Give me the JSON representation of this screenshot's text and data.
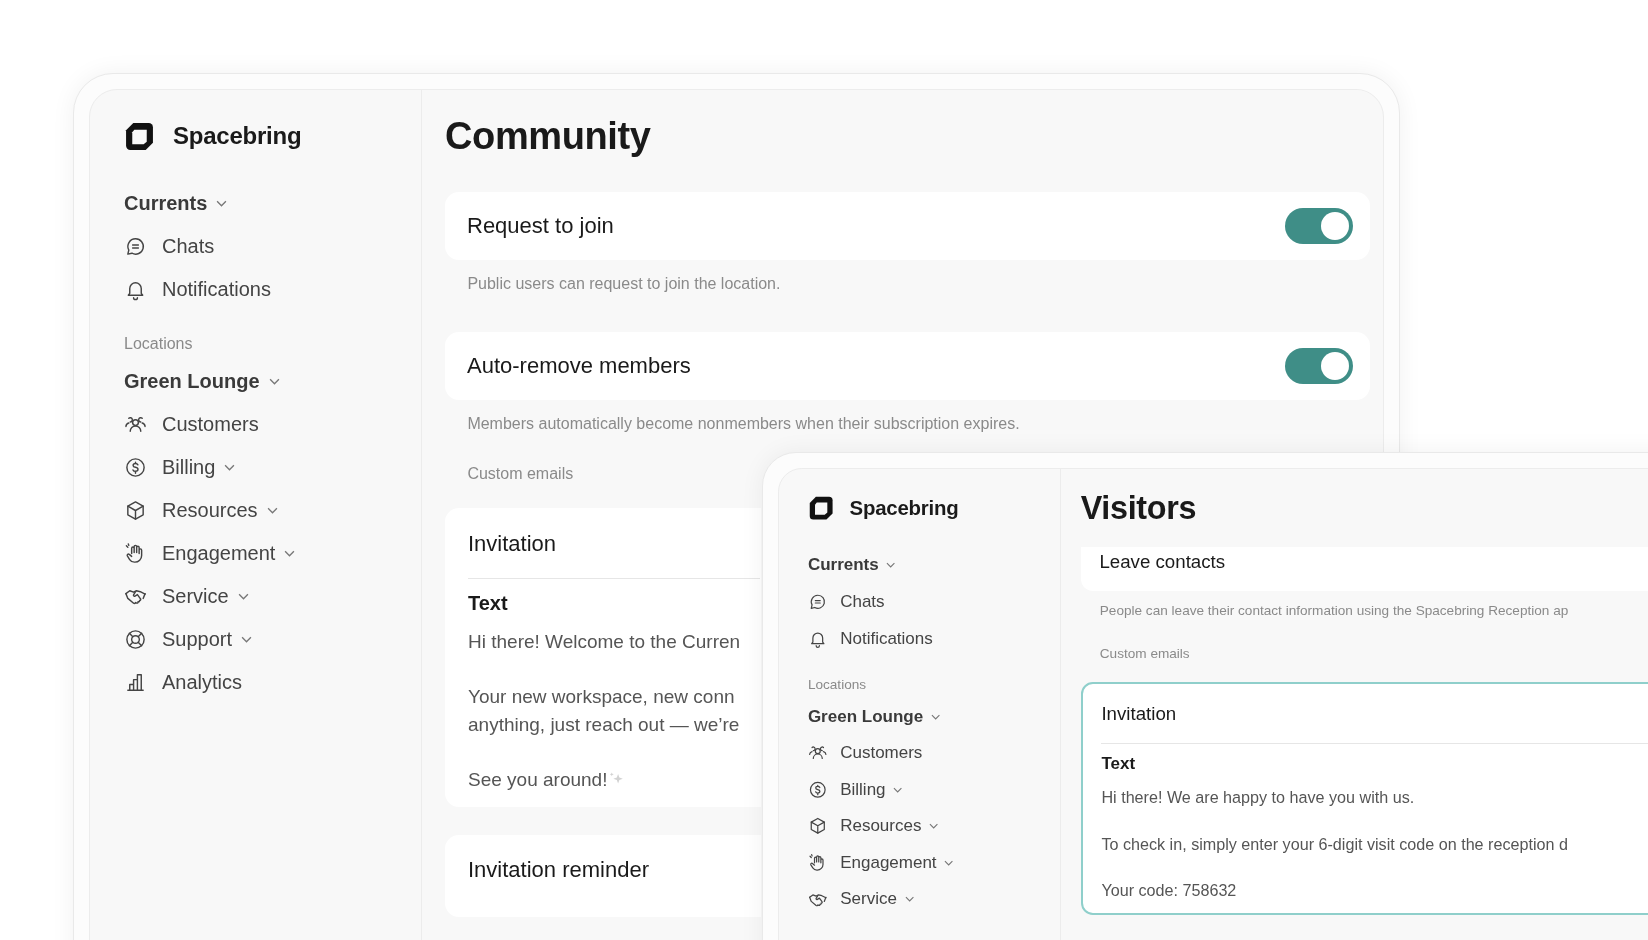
{
  "windows": [
    {
      "brand": "Spacebring",
      "sidebar": [
        {
          "kind": "group",
          "label": "Currents"
        },
        {
          "kind": "item",
          "label": "Chats",
          "expandable": false
        },
        {
          "kind": "item",
          "label": "Notifications",
          "expandable": false
        },
        {
          "kind": "caption",
          "label": "Locations"
        },
        {
          "kind": "group",
          "label": "Green Lounge"
        },
        {
          "kind": "item",
          "label": "Customers",
          "expandable": false
        },
        {
          "kind": "item",
          "label": "Billing",
          "expandable": true
        },
        {
          "kind": "item",
          "label": "Resources",
          "expandable": true
        },
        {
          "kind": "item",
          "label": "Engagement",
          "expandable": true
        },
        {
          "kind": "item",
          "label": "Service",
          "expandable": true
        },
        {
          "kind": "item",
          "label": "Support",
          "expandable": true
        },
        {
          "kind": "item",
          "label": "Analytics",
          "expandable": false
        }
      ],
      "main": {
        "title": "Community",
        "scrolled": false,
        "overlapped": true,
        "settings": [
          {
            "label": "Request to join",
            "on": true,
            "description": "Public users can request to join the location."
          },
          {
            "label": "Auto-remove members",
            "on": true,
            "description": "Members automatically become nonmembers when their subscription expires."
          }
        ],
        "emails_label": "Custom emails",
        "emails": [
          {
            "title": "Invitation",
            "selected": false,
            "field_label": "Text",
            "paragraphs": [
              {
                "text": "Hi there! Welcome to the Curren"
              },
              {
                "text": "Your new workspace, new conn\nanything, just reach out — we’re"
              },
              {
                "text": "See you around!"
              }
            ]
          },
          {
            "title": "Invitation reminder",
            "selected": false
          }
        ]
      }
    },
    {
      "brand": "Spacebring",
      "sidebar": [
        {
          "kind": "group",
          "label": "Currents"
        },
        {
          "kind": "item",
          "label": "Chats",
          "expandable": false
        },
        {
          "kind": "item",
          "label": "Notifications",
          "expandable": false
        },
        {
          "kind": "caption",
          "label": "Locations"
        },
        {
          "kind": "group",
          "label": "Green Lounge"
        },
        {
          "kind": "item",
          "label": "Customers",
          "expandable": false
        },
        {
          "kind": "item",
          "label": "Billing",
          "expandable": true
        },
        {
          "kind": "item",
          "label": "Resources",
          "expandable": true
        },
        {
          "kind": "item",
          "label": "Engagement",
          "expandable": true
        },
        {
          "kind": "item",
          "label": "Service",
          "expandable": true
        }
      ],
      "main": {
        "title": "Visitors",
        "scrolled": true,
        "overlapped": false,
        "settings": [
          {
            "label": "Leave contacts",
            "description": "People can leave their contact information using the Spacebring Reception ap"
          }
        ],
        "emails_label": "Custom emails",
        "emails": [
          {
            "title": "Invitation",
            "selected": true,
            "field_label": "Text",
            "paragraphs": [
              {
                "text": "Hi there! We are happy to have you with us."
              },
              {
                "text": "To check in, simply enter your 6-digit visit code on the reception d"
              },
              {
                "text": "Your code: 758632"
              }
            ]
          }
        ]
      }
    }
  ]
}
